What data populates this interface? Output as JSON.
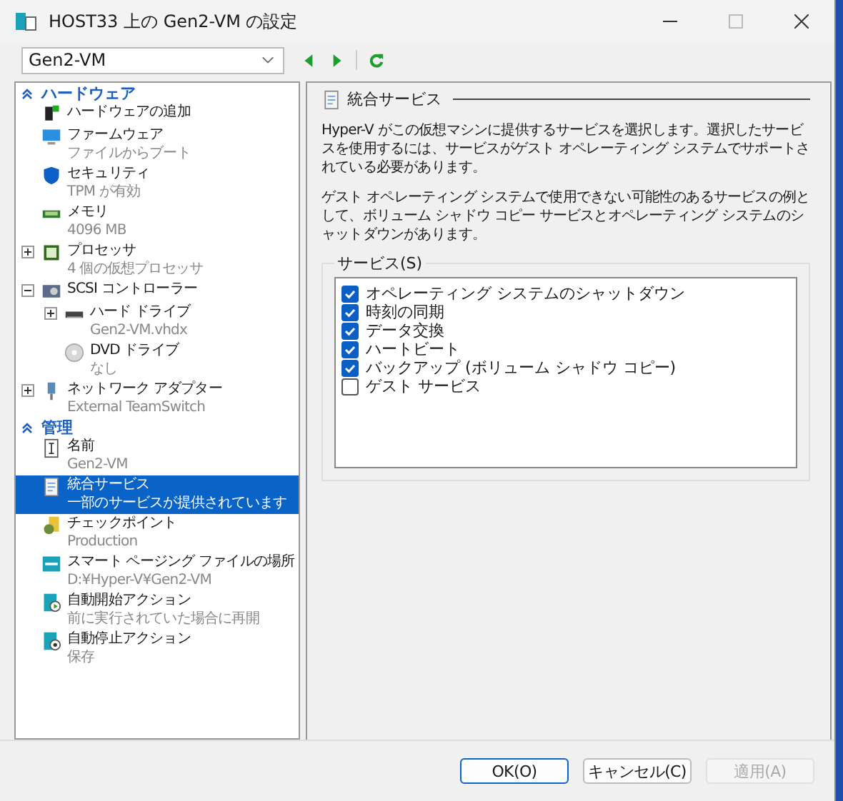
{
  "window": {
    "title": "HOST33 上の Gen2-VM の設定"
  },
  "toolbar": {
    "vm_select": "Gen2-VM"
  },
  "sidebar": {
    "sections": [
      {
        "title": "ハードウェア",
        "expanded": true,
        "items": [
          {
            "label": "ハードウェアの追加",
            "selected": false
          },
          {
            "label": "ファームウェア",
            "detail": "ファイルからブート",
            "selected": false
          },
          {
            "label": "セキュリティ",
            "detail": "TPM が有効",
            "selected": false
          },
          {
            "label": "メモリ",
            "detail": "4096 MB",
            "selected": false
          },
          {
            "label": "プロセッサ",
            "detail": "4 個の仮想プロセッサ",
            "selected": false,
            "expanded": false
          },
          {
            "label": "SCSI コントローラー",
            "selected": false,
            "expanded": true,
            "children": [
              {
                "label": "ハード ドライブ",
                "detail": "Gen2-VM.vhdx",
                "selected": false,
                "expanded": false
              },
              {
                "label": "DVD ドライブ",
                "detail": "なし",
                "selected": false
              }
            ]
          },
          {
            "label": "ネットワーク アダプター",
            "detail": "External TeamSwitch",
            "selected": false,
            "expanded": false
          }
        ]
      },
      {
        "title": "管理",
        "expanded": true,
        "items": [
          {
            "label": "名前",
            "detail": "Gen2-VM",
            "selected": false
          },
          {
            "label": "統合サービス",
            "detail": "一部のサービスが提供されています",
            "selected": true
          },
          {
            "label": "チェックポイント",
            "detail": "Production",
            "selected": false
          },
          {
            "label": "スマート ページング ファイルの場所",
            "detail": "D:¥Hyper-V¥Gen2-VM",
            "selected": false
          },
          {
            "label": "自動開始アクション",
            "detail": "前に実行されていた場合に再開",
            "selected": false
          },
          {
            "label": "自動停止アクション",
            "detail": "保存",
            "selected": false
          }
        ]
      }
    ]
  },
  "panel": {
    "title": "統合サービス",
    "paragraphs": [
      "Hyper-V がこの仮想マシンに提供するサービスを選択します。選択したサービスを使用するには、サービスがゲスト オペレーティング システムでサポートされている必要があります。",
      "ゲスト オペレーティング システムで使用できない可能性のあるサービスの例として、ボリューム シャドウ コピー サービスとオペレーティング システムのシャットダウンがあります。"
    ],
    "group_label": "サービス(S)",
    "services": [
      {
        "label": "オペレーティング システムのシャットダウン",
        "checked": true
      },
      {
        "label": "時刻の同期",
        "checked": true
      },
      {
        "label": "データ交換",
        "checked": true
      },
      {
        "label": "ハートビート",
        "checked": true
      },
      {
        "label": "バックアップ (ボリューム シャドウ コピー)",
        "checked": true
      },
      {
        "label": "ゲスト サービス",
        "checked": false
      }
    ]
  },
  "buttons": [
    {
      "label": "OK(O)",
      "default": true,
      "disabled": false
    },
    {
      "label": "キャンセル(C)",
      "default": false,
      "disabled": false
    },
    {
      "label": "適用(A)",
      "default": false,
      "disabled": true
    }
  ]
}
